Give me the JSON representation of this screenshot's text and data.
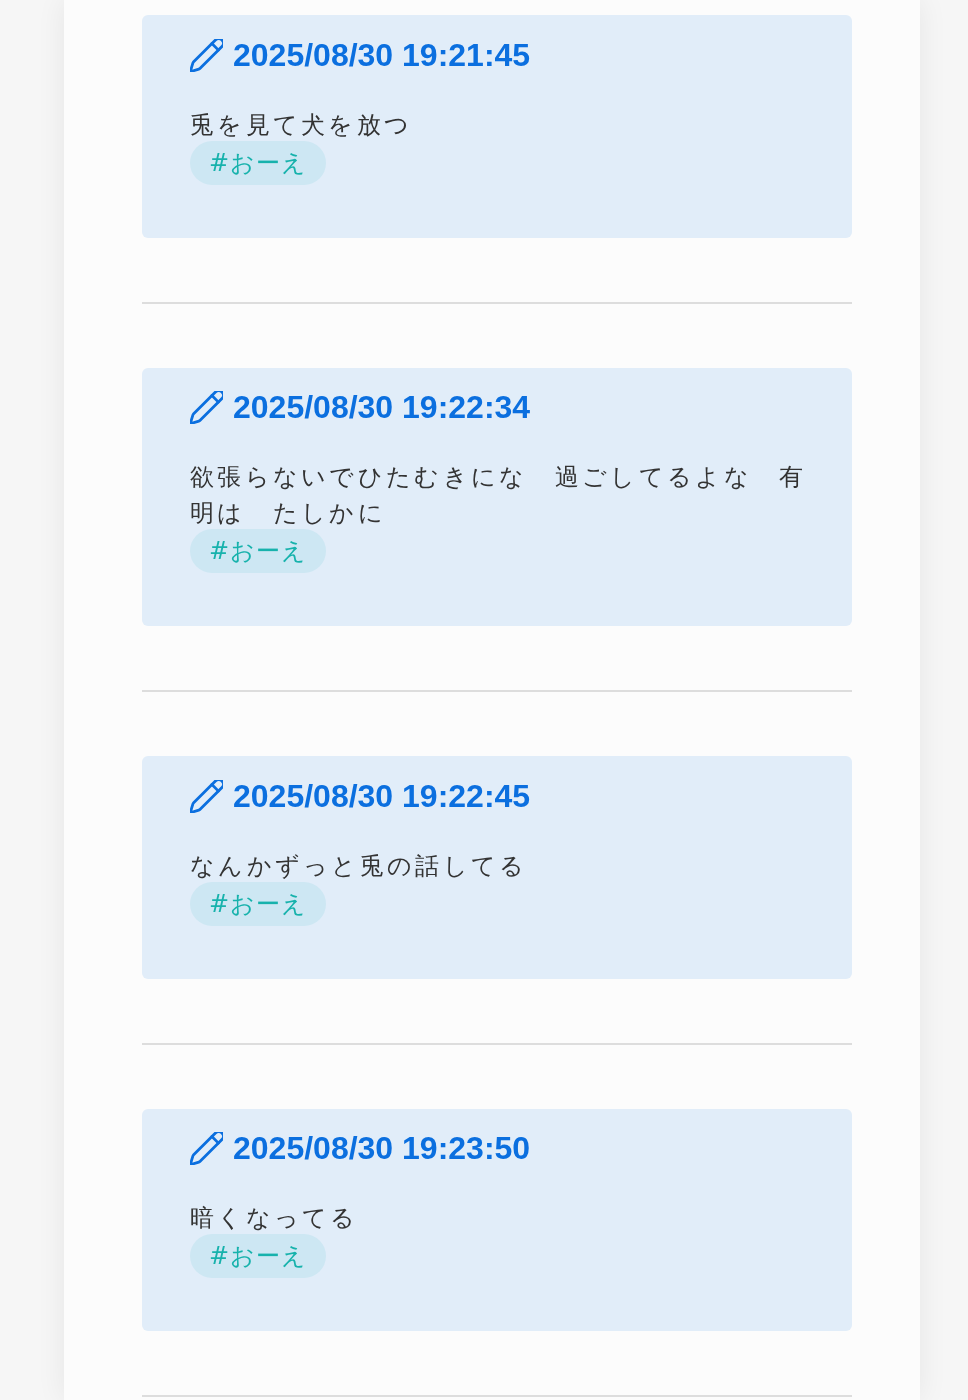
{
  "posts": [
    {
      "timestamp": "2025/08/30 19:21:45",
      "text": "兎を見て犬を放つ",
      "tags": [
        "#おーえ"
      ]
    },
    {
      "timestamp": "2025/08/30 19:22:34",
      "text": "欲張らないでひたむきにな　過ごしてるよな　有明は　たしかに",
      "tags": [
        "#おーえ"
      ]
    },
    {
      "timestamp": "2025/08/30 19:22:45",
      "text": "なんかずっと兎の話してる",
      "tags": [
        "#おーえ"
      ]
    },
    {
      "timestamp": "2025/08/30 19:23:50",
      "text": "暗くなってる",
      "tags": [
        "#おーえ"
      ]
    }
  ]
}
